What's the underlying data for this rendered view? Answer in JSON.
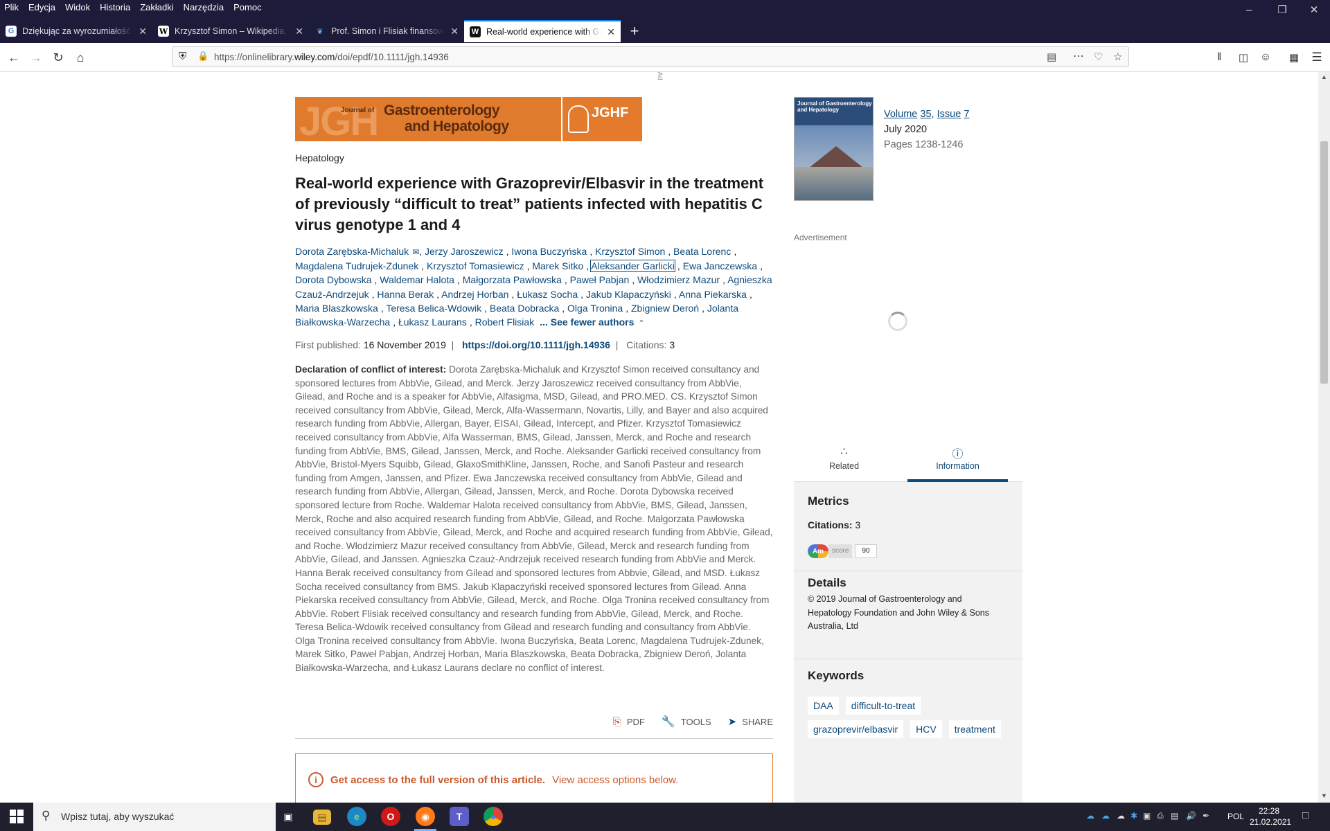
{
  "menu": [
    "Plik",
    "Edycja",
    "Widok",
    "Historia",
    "Zakładki",
    "Narzędzia",
    "Pomoc"
  ],
  "tabs": [
    {
      "title": "Dziękując za wyrozumiałość, życz",
      "icon": "google-icon",
      "active": false
    },
    {
      "title": "Krzysztof Simon – Wikipedia, wol",
      "icon": "wikipedia-icon",
      "active": false
    },
    {
      "title": "Prof. Simon i Flisiak finansowan",
      "icon": "feather-icon",
      "active": false
    },
    {
      "title": "Real-world experience with Graz",
      "icon": "wiley-icon",
      "active": true
    }
  ],
  "url": {
    "prefix": "https://onlinelibrary.",
    "host": "wiley.com",
    "path": "/doi/epdf/10.1111/jgh.14936"
  },
  "article": {
    "banner_journal_of": "Journal of",
    "banner_gastro": "Gastroenterology",
    "banner_hep": "and Hepatology",
    "banner_jghf": "JGHF",
    "category": "Hepatology",
    "title": "Real-world experience with Grazoprevir/Elbasvir in the treatment of previously “difficult to treat” patients infected with hepatitis C virus genotype 1 and 4",
    "authors": [
      "Dorota Zarębska-Michaluk",
      "Jerzy Jaroszewicz",
      "Iwona Buczyńska",
      "Krzysztof Simon",
      "Beata Lorenc",
      "Magdalena Tudrujek-Zdunek",
      "Krzysztof Tomasiewicz",
      "Marek Sitko",
      "Aleksander Garlicki",
      "Ewa Janczewska",
      "Dorota Dybowska",
      "Waldemar Halota",
      "Małgorzata Pawłowska",
      "Paweł Pabjan",
      "Włodzimierz Mazur",
      "Agnieszka Czauż-Andrzejuk",
      "Hanna Berak",
      "Andrzej Horban",
      "Łukasz Socha",
      "Jakub Klapaczyński",
      "Anna Piekarska",
      "Maria Blaszkowska",
      "Teresa Belica-Wdowik",
      "Beata Dobracka",
      "Olga Tronina",
      "Zbigniew Deroń",
      "Jolanta Białkowska-Warzecha",
      "Łukasz Laurans",
      "Robert Flisiak"
    ],
    "see_fewer": "... See fewer authors",
    "first_published_label": "First published:",
    "first_published": "16 November 2019",
    "doi": "https://doi.org/10.1111/jgh.14936",
    "citations_label": "Citations:",
    "citations": "3",
    "coi_label": "Declaration of conflict of interest:",
    "coi_text": "Dorota Zarębska-Michaluk and Krzysztof Simon received consultancy and sponsored lectures from AbbVie, Gilead, and Merck. Jerzy Jaroszewicz received consultancy from AbbVie, Gilead, and Roche and is a speaker for AbbVie, Alfasigma, MSD, Gilead, and PRO.MED. CS. Krzysztof Simon received consultancy from AbbVie, Gilead, Merck, Alfa-Wassermann, Novartis, Lilly, and Bayer and also acquired research funding from AbbVie, Allergan, Bayer, EISAI, Gilead, Intercept, and Pfizer. Krzysztof Tomasiewicz received consultancy from AbbVie, Alfa Wasserman, BMS, Gilead, Janssen, Merck, and Roche and research funding from AbbVie, BMS, Gilead, Janssen, Merck, and Roche. Aleksander Garlicki received consultancy from AbbVie, Bristol-Myers Squibb, Gilead, GlaxoSmithKline, Janssen, Roche, and Sanofi Pasteur and research funding from Amgen, Janssen, and Pfizer. Ewa Janczewska received consultancy from AbbVie, Gilead and research funding from AbbVie, Allergan, Gilead, Janssen, Merck, and Roche. Dorota Dybowska received sponsored lecture from Roche. Waldemar Halota received consultancy from AbbVie, BMS, Gilead, Janssen, Merck, Roche and also acquired research funding from AbbVie, Gilead, and Roche. Małgorzata Pawłowska received consultancy from AbbVie, Gilead, Merck, and Roche and acquired research funding from AbbVie, Gilead, and Roche. Włodzimierz Mazur received consultancy from AbbVie, Gilead, Merck and research funding from AbbVie, Gilead, and Janssen. Agnieszka Czauż-Andrzejuk received research funding from AbbVie and Merck. Hanna Berak received consultancy from Gilead and sponsored lectures from Abbvie, Gilead, and MSD. Łukasz Socha received consultancy from BMS. Jakub Klapaczyński received sponsored lectures from Gilead. Anna Piekarska received consultancy from AbbVie, Gilead, Merck, and Roche. Olga Tronina received consultancy from AbbVie. Robert Flisiak received consultancy and research funding from AbbVie, Gilead, Merck, and Roche. Teresa Belica-Wdowik received consultancy from Gilead and research funding and consultancy from AbbVie. Olga Tronina received consultancy from AbbVie. Iwona Buczyńska, Beata Lorenc, Magdalena Tudrujek-Zdunek, Marek Sitko, Paweł Pabjan, Andrzej Horban, Maria Blaszkowska, Beata Dobracka, Zbigniew Deroń, Jolanta Białkowska-Warzecha, and Łukasz Laurans declare no conflict of interest.",
    "actions": {
      "pdf": "PDF",
      "tools": "TOOLS",
      "share": "SHARE"
    },
    "access_strong": "Get access to the full version of this article.",
    "access_rest": "View access options below."
  },
  "sidebar": {
    "cover_title": "Journal of Gastroenterology and Hepatology",
    "volume_label": "Volume",
    "volume": "35",
    "issue_label": "Issue",
    "issue": "7",
    "date": "July 2020",
    "pages": "Pages 1238-1246",
    "ad_label": "Advertisement",
    "tab_related": "Related",
    "tab_information": "Information",
    "metrics_h": "Metrics",
    "citations_label": "Citations:",
    "citations": "3",
    "altmetric_am": "Am",
    "altmetric_score_label": "score",
    "altmetric_score": "90",
    "details_h": "Details",
    "copyright": "© 2019 Journal of Gastroenterology and Hepatology Foundation and John Wiley & Sons Australia, Ltd",
    "keywords_h": "Keywords",
    "keywords": [
      "DAA",
      "difficult-to-treat",
      "grazoprevir/elbasvir",
      "HCV",
      "treatment"
    ]
  },
  "taskbar": {
    "search_placeholder": "Wpisz tutaj, aby wyszukać",
    "lang": "POL",
    "time": "22:28",
    "date": "21.02.2021"
  }
}
